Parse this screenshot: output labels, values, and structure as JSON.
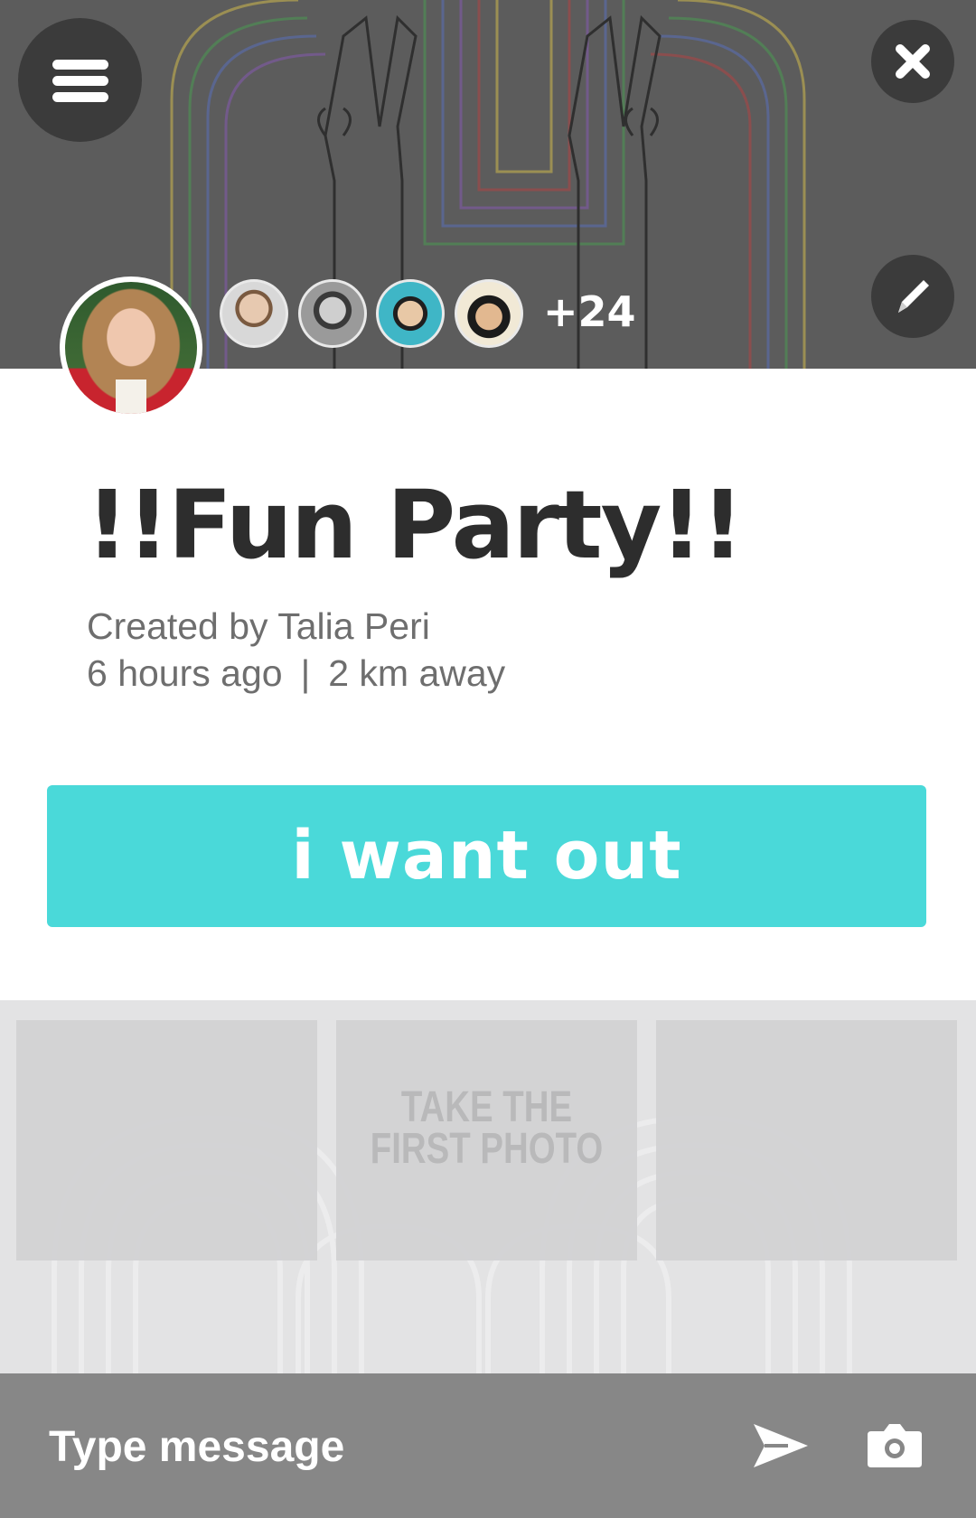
{
  "header": {
    "menu_icon": "hamburger-menu-icon",
    "close_icon": "close-icon",
    "edit_icon": "pencil-icon",
    "attendee_overflow": "+24"
  },
  "event": {
    "title": "!!Fun Party!!",
    "created_by": "Created  by Talia Peri",
    "time_ago": "6 hours ago",
    "separator": "|",
    "distance": "2 km away",
    "action_label": "i want out"
  },
  "photos": {
    "empty_label": "TAKE THE\nFIRST PHOTO"
  },
  "composer": {
    "placeholder": "Type message",
    "send_icon": "send-icon",
    "camera_icon": "camera-icon"
  },
  "colors": {
    "accent": "#4ad9d9",
    "header_bg": "#5c5c5c",
    "composer_bg": "#878787",
    "title": "#2d2d2d"
  }
}
